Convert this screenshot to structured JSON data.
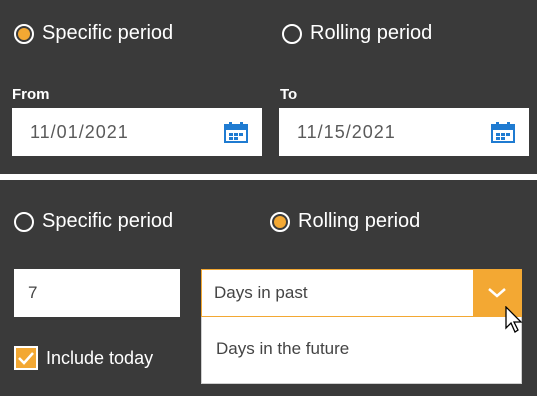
{
  "specific_panel": {
    "radio_specific_label": "Specific period",
    "radio_specific_checked": true,
    "radio_rolling_label": "Rolling period",
    "radio_rolling_checked": false,
    "from_label": "From",
    "from_value": "11/01/2021",
    "to_label": "To",
    "to_value": "11/15/2021"
  },
  "rolling_panel": {
    "radio_specific_label": "Specific period",
    "radio_specific_checked": false,
    "radio_rolling_label": "Rolling period",
    "radio_rolling_checked": true,
    "count_value": "7",
    "select_value": "Days in past",
    "select_options": [
      "Days in the future"
    ],
    "include_today_label": "Include today",
    "include_today_checked": true
  },
  "colors": {
    "panel_bg": "#3a3a3a",
    "accent": "#f3a833",
    "calendar_icon": "#1f7bd1"
  },
  "icons": [
    "calendar-icon",
    "chevron-down-icon",
    "checkmark-icon",
    "mouse-cursor-icon"
  ]
}
